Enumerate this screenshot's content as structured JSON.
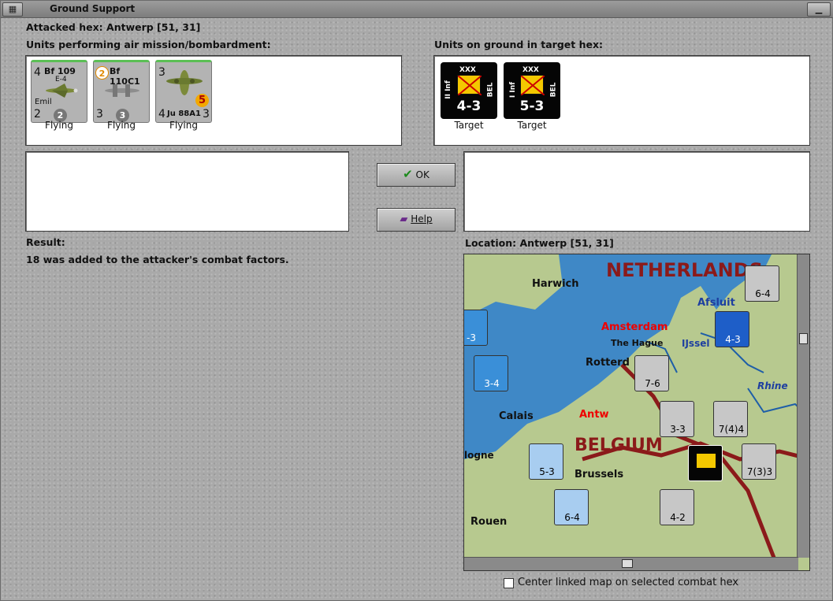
{
  "window": {
    "title": "Ground Support"
  },
  "header": {
    "attacked_hex": "Attacked hex: Antwerp  [51, 31]"
  },
  "air_panel": {
    "label": "Units performing air mission/bombardment:",
    "units": [
      {
        "name": "Bf 109",
        "subname": "E-4",
        "pilot": "Emil",
        "top_left": "4",
        "bottom_left": "2",
        "circle": "2",
        "status": "Flying"
      },
      {
        "name": "Bf 110C1",
        "top_left": "2",
        "bottom_left": "3",
        "circle": "3",
        "status": "Flying"
      },
      {
        "name": "Ju 88A1",
        "top_left": "3",
        "bottom_left": "4",
        "bottom_right": "3",
        "circle": "5",
        "status": "Flying"
      }
    ]
  },
  "ground_panel": {
    "label": "Units on ground in target hex:",
    "units": [
      {
        "size": "XXX",
        "type": "II Inf",
        "nation": "BEL",
        "value": "4-3",
        "status": "Target"
      },
      {
        "size": "XXX",
        "type": "I Inf",
        "nation": "BEL",
        "value": "5-3",
        "status": "Target"
      }
    ]
  },
  "buttons": {
    "ok": "OK",
    "help": "Help"
  },
  "result": {
    "label": "Result:",
    "text": "18 was added to the attacker's combat factors."
  },
  "location": {
    "label": "Location:  Antwerp  [51, 31]"
  },
  "map": {
    "labels": {
      "netherlands": "NETHERLANDS",
      "belgium": "BELGIUM",
      "harwich": "Harwich",
      "amsterdam": "Amsterdam",
      "the_hague": "The Hague",
      "ijssel": "IJssel",
      "rotterdam": "Rotterd",
      "afsluit": "Afsluit",
      "rhine": "Rhine",
      "calais": "Calais",
      "antwerp": "Antw",
      "brussels": "Brussels",
      "rouen": "Rouen",
      "logne": "logne"
    },
    "units": [
      {
        "value": "6-4"
      },
      {
        "value": "4-3"
      },
      {
        "value": "7-6"
      },
      {
        "value": "3-3"
      },
      {
        "value": "7(4)4"
      },
      {
        "value": "5-3"
      },
      {
        "value": "6-4"
      },
      {
        "value": "4-2"
      },
      {
        "value": "7(3)3"
      },
      {
        "value": "3-4"
      },
      {
        "value": "-3"
      }
    ],
    "colors": {
      "sea": "#3f88c6",
      "land": "#b7c98f",
      "border": "#8b1a1a"
    }
  },
  "footer": {
    "checkbox_label": "Center linked map on selected combat hex"
  }
}
